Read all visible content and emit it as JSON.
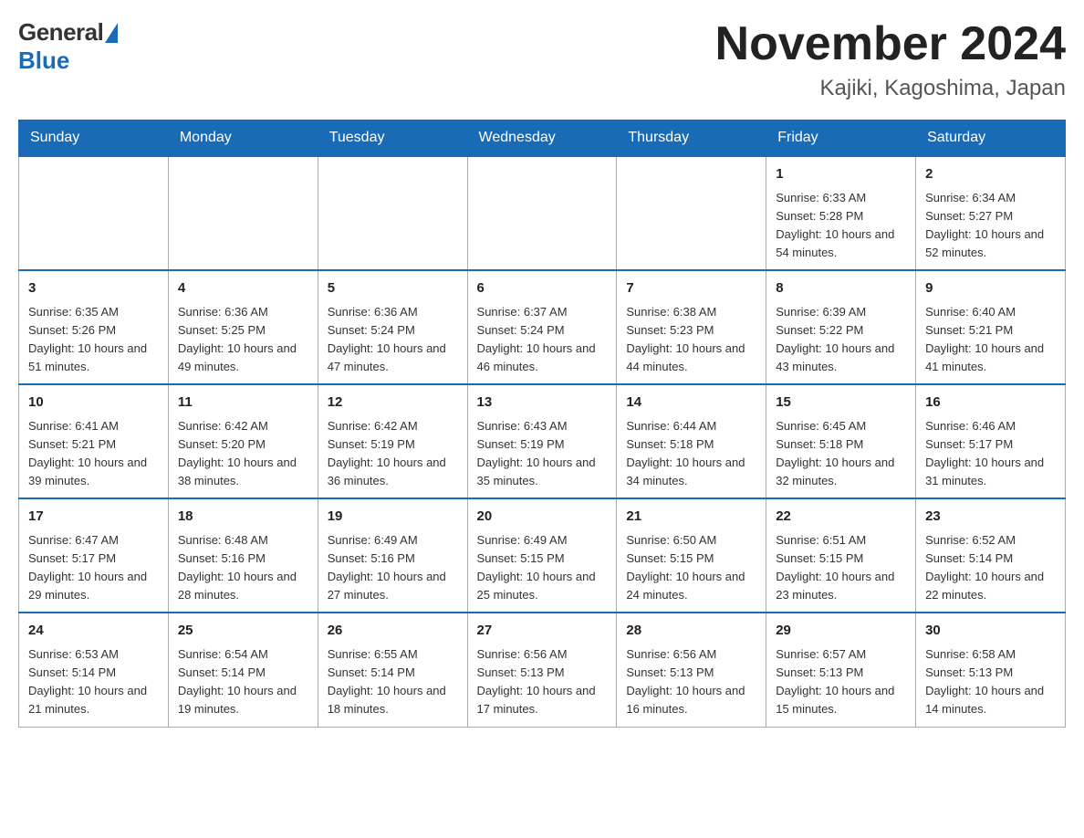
{
  "header": {
    "logo": {
      "general": "General",
      "blue": "Blue"
    },
    "title": "November 2024",
    "location": "Kajiki, Kagoshima, Japan"
  },
  "weekdays": [
    "Sunday",
    "Monday",
    "Tuesday",
    "Wednesday",
    "Thursday",
    "Friday",
    "Saturday"
  ],
  "weeks": [
    [
      {
        "day": "",
        "info": ""
      },
      {
        "day": "",
        "info": ""
      },
      {
        "day": "",
        "info": ""
      },
      {
        "day": "",
        "info": ""
      },
      {
        "day": "",
        "info": ""
      },
      {
        "day": "1",
        "info": "Sunrise: 6:33 AM\nSunset: 5:28 PM\nDaylight: 10 hours and 54 minutes."
      },
      {
        "day": "2",
        "info": "Sunrise: 6:34 AM\nSunset: 5:27 PM\nDaylight: 10 hours and 52 minutes."
      }
    ],
    [
      {
        "day": "3",
        "info": "Sunrise: 6:35 AM\nSunset: 5:26 PM\nDaylight: 10 hours and 51 minutes."
      },
      {
        "day": "4",
        "info": "Sunrise: 6:36 AM\nSunset: 5:25 PM\nDaylight: 10 hours and 49 minutes."
      },
      {
        "day": "5",
        "info": "Sunrise: 6:36 AM\nSunset: 5:24 PM\nDaylight: 10 hours and 47 minutes."
      },
      {
        "day": "6",
        "info": "Sunrise: 6:37 AM\nSunset: 5:24 PM\nDaylight: 10 hours and 46 minutes."
      },
      {
        "day": "7",
        "info": "Sunrise: 6:38 AM\nSunset: 5:23 PM\nDaylight: 10 hours and 44 minutes."
      },
      {
        "day": "8",
        "info": "Sunrise: 6:39 AM\nSunset: 5:22 PM\nDaylight: 10 hours and 43 minutes."
      },
      {
        "day": "9",
        "info": "Sunrise: 6:40 AM\nSunset: 5:21 PM\nDaylight: 10 hours and 41 minutes."
      }
    ],
    [
      {
        "day": "10",
        "info": "Sunrise: 6:41 AM\nSunset: 5:21 PM\nDaylight: 10 hours and 39 minutes."
      },
      {
        "day": "11",
        "info": "Sunrise: 6:42 AM\nSunset: 5:20 PM\nDaylight: 10 hours and 38 minutes."
      },
      {
        "day": "12",
        "info": "Sunrise: 6:42 AM\nSunset: 5:19 PM\nDaylight: 10 hours and 36 minutes."
      },
      {
        "day": "13",
        "info": "Sunrise: 6:43 AM\nSunset: 5:19 PM\nDaylight: 10 hours and 35 minutes."
      },
      {
        "day": "14",
        "info": "Sunrise: 6:44 AM\nSunset: 5:18 PM\nDaylight: 10 hours and 34 minutes."
      },
      {
        "day": "15",
        "info": "Sunrise: 6:45 AM\nSunset: 5:18 PM\nDaylight: 10 hours and 32 minutes."
      },
      {
        "day": "16",
        "info": "Sunrise: 6:46 AM\nSunset: 5:17 PM\nDaylight: 10 hours and 31 minutes."
      }
    ],
    [
      {
        "day": "17",
        "info": "Sunrise: 6:47 AM\nSunset: 5:17 PM\nDaylight: 10 hours and 29 minutes."
      },
      {
        "day": "18",
        "info": "Sunrise: 6:48 AM\nSunset: 5:16 PM\nDaylight: 10 hours and 28 minutes."
      },
      {
        "day": "19",
        "info": "Sunrise: 6:49 AM\nSunset: 5:16 PM\nDaylight: 10 hours and 27 minutes."
      },
      {
        "day": "20",
        "info": "Sunrise: 6:49 AM\nSunset: 5:15 PM\nDaylight: 10 hours and 25 minutes."
      },
      {
        "day": "21",
        "info": "Sunrise: 6:50 AM\nSunset: 5:15 PM\nDaylight: 10 hours and 24 minutes."
      },
      {
        "day": "22",
        "info": "Sunrise: 6:51 AM\nSunset: 5:15 PM\nDaylight: 10 hours and 23 minutes."
      },
      {
        "day": "23",
        "info": "Sunrise: 6:52 AM\nSunset: 5:14 PM\nDaylight: 10 hours and 22 minutes."
      }
    ],
    [
      {
        "day": "24",
        "info": "Sunrise: 6:53 AM\nSunset: 5:14 PM\nDaylight: 10 hours and 21 minutes."
      },
      {
        "day": "25",
        "info": "Sunrise: 6:54 AM\nSunset: 5:14 PM\nDaylight: 10 hours and 19 minutes."
      },
      {
        "day": "26",
        "info": "Sunrise: 6:55 AM\nSunset: 5:14 PM\nDaylight: 10 hours and 18 minutes."
      },
      {
        "day": "27",
        "info": "Sunrise: 6:56 AM\nSunset: 5:13 PM\nDaylight: 10 hours and 17 minutes."
      },
      {
        "day": "28",
        "info": "Sunrise: 6:56 AM\nSunset: 5:13 PM\nDaylight: 10 hours and 16 minutes."
      },
      {
        "day": "29",
        "info": "Sunrise: 6:57 AM\nSunset: 5:13 PM\nDaylight: 10 hours and 15 minutes."
      },
      {
        "day": "30",
        "info": "Sunrise: 6:58 AM\nSunset: 5:13 PM\nDaylight: 10 hours and 14 minutes."
      }
    ]
  ]
}
